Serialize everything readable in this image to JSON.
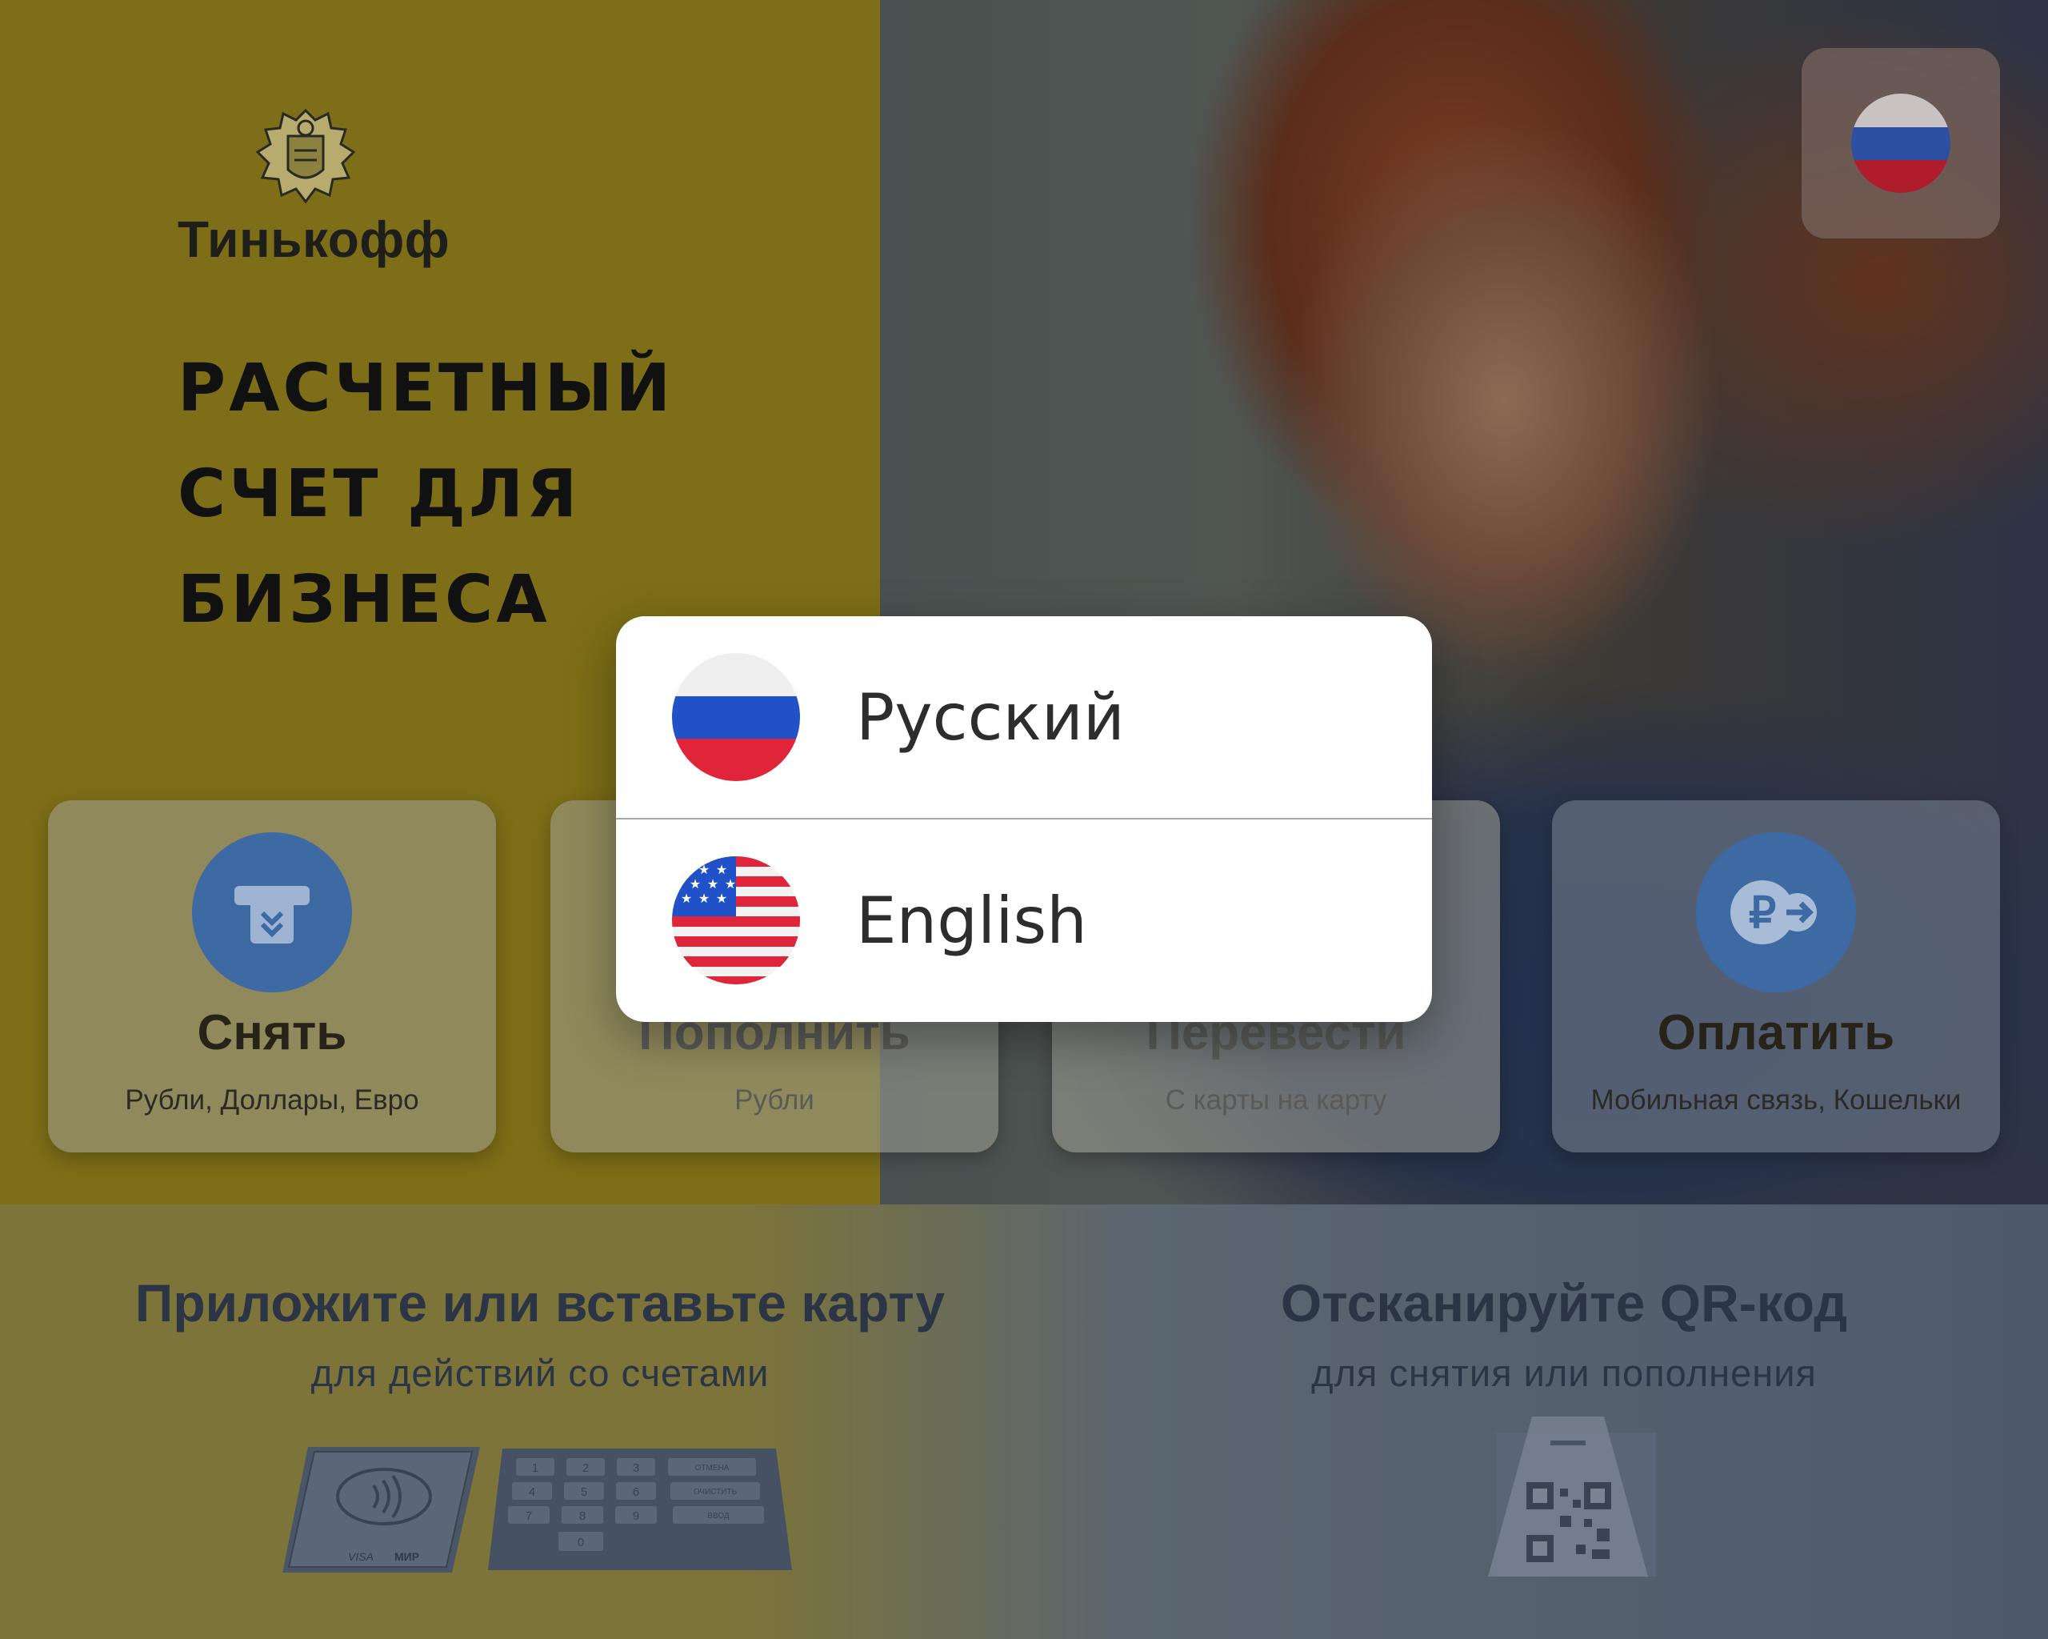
{
  "brand": {
    "name": "Тинькофф"
  },
  "headline": [
    "РАСЧЕТНЫЙ",
    "СЧЕТ ДЛЯ",
    "БИЗНЕСА"
  ],
  "language_button": {
    "current": "ru",
    "icon": "russian-flag-icon"
  },
  "tiles": [
    {
      "title": "Снять",
      "subtitle": "Рубли, Доллары, Евро",
      "icon": "atm-withdraw-icon"
    },
    {
      "title": "Пополнить",
      "subtitle": "Рубли",
      "icon": "deposit-icon"
    },
    {
      "title": "Перевести",
      "subtitle": "С карты на карту",
      "icon": "transfer-icon"
    },
    {
      "title": "Оплатить",
      "subtitle": "Мобильная связь, Кошельки",
      "icon": "ruble-pay-icon"
    }
  ],
  "card_section": {
    "title": "Приложите или вставьте карту",
    "subtitle": "для действий со счетами",
    "card_logos": [
      "VISA",
      "МИР"
    ],
    "pinpad_keys": [
      "1",
      "2",
      "3",
      "4",
      "5",
      "6",
      "7",
      "8",
      "9",
      "0"
    ],
    "pinpad_side_keys": [
      "ОТМЕНА",
      "ОЧИСТИТЬ",
      "ВВОД"
    ]
  },
  "qr_section": {
    "title": "Отсканируйте QR-код",
    "subtitle": "для снятия или пополнения"
  },
  "language_dialog": {
    "options": [
      {
        "label": "Русский",
        "icon": "russian-flag-icon"
      },
      {
        "label": "English",
        "icon": "us-flag-icon"
      }
    ]
  },
  "colors": {
    "brand_yellow_dimmed": "#7d6e17",
    "icon_blue": "#3e6aa4",
    "dialog_bg": "#ffffff"
  }
}
